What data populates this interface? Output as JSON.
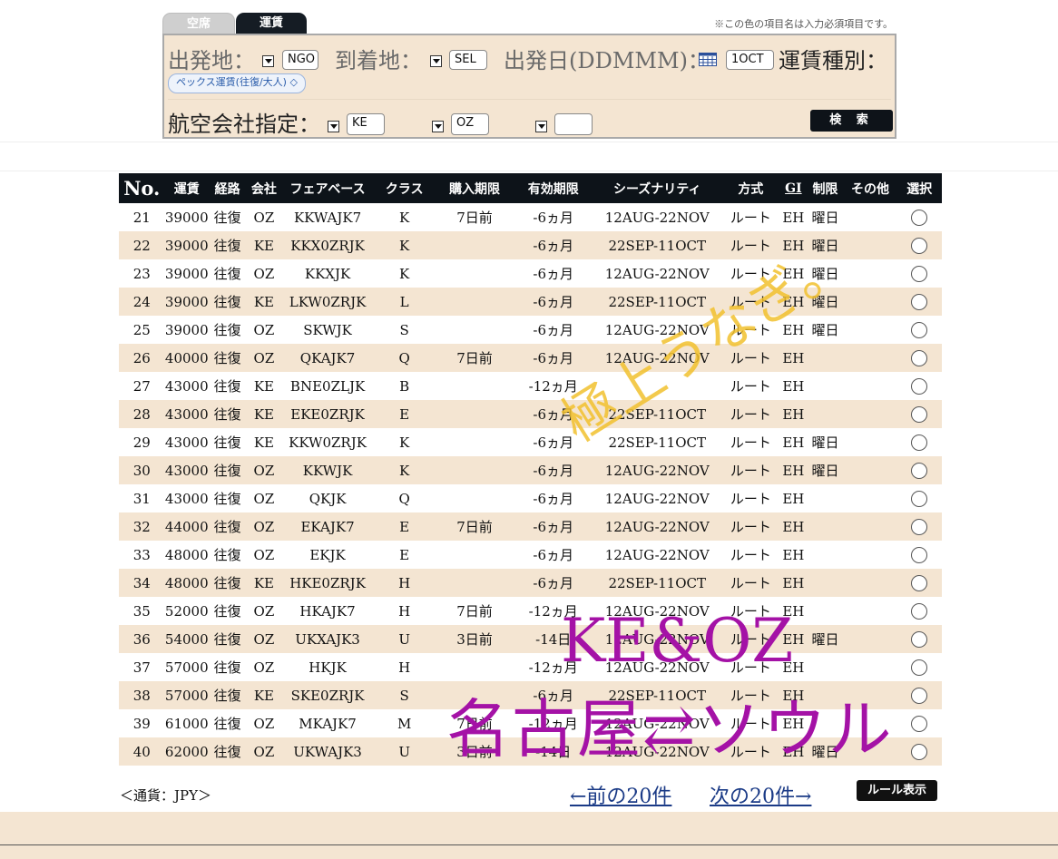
{
  "tabs": {
    "availability": "空席",
    "fare": "運賃"
  },
  "note": "※この色の項目名は入力必須項目です。",
  "search": {
    "origin_label": "出発地：",
    "origin_value": "NGO",
    "dest_label": "到着地：",
    "dest_value": "SEL",
    "date_label": "出発日(DDMMM)：",
    "date_value": "1OCT",
    "fare_type_label": "運賃種別：",
    "fare_type_value": "ペックス運賃(往復/大人)",
    "airline_label": "航空会社指定：",
    "airline1": "KE",
    "airline2": "OZ",
    "airline3": "",
    "search_button": "検 索"
  },
  "table": {
    "headers": [
      "No.",
      "運賃",
      "経路",
      "会社",
      "フェアベース",
      "クラス",
      "購入期限",
      "有効期限",
      "シーズナリティ",
      "方式",
      "GI",
      "制限",
      "その他",
      "選択"
    ],
    "rows": [
      [
        "21",
        "39000",
        "往復",
        "OZ",
        "KKWAJK7",
        "K",
        "7日前",
        "-6ヵ月",
        "12AUG-22NOV",
        "ルート",
        "EH",
        "曜日",
        ""
      ],
      [
        "22",
        "39000",
        "往復",
        "KE",
        "KKX0ZRJK",
        "K",
        "",
        "-6ヵ月",
        "22SEP-11OCT",
        "ルート",
        "EH",
        "曜日",
        ""
      ],
      [
        "23",
        "39000",
        "往復",
        "OZ",
        "KKXJK",
        "K",
        "",
        "-6ヵ月",
        "12AUG-22NOV",
        "ルート",
        "EH",
        "曜日",
        ""
      ],
      [
        "24",
        "39000",
        "往復",
        "KE",
        "LKW0ZRJK",
        "L",
        "",
        "-6ヵ月",
        "22SEP-11OCT",
        "ルート",
        "EH",
        "曜日",
        ""
      ],
      [
        "25",
        "39000",
        "往復",
        "OZ",
        "SKWJK",
        "S",
        "",
        "-6ヵ月",
        "12AUG-22NOV",
        "ルート",
        "EH",
        "曜日",
        ""
      ],
      [
        "26",
        "40000",
        "往復",
        "OZ",
        "QKAJK7",
        "Q",
        "7日前",
        "-6ヵ月",
        "12AUG-22NOV",
        "ルート",
        "EH",
        "",
        ""
      ],
      [
        "27",
        "43000",
        "往復",
        "KE",
        "BNE0ZLJK",
        "B",
        "",
        "-12ヵ月",
        "",
        "ルート",
        "EH",
        "",
        ""
      ],
      [
        "28",
        "43000",
        "往復",
        "KE",
        "EKE0ZRJK",
        "E",
        "",
        "-6ヵ月",
        "22SEP-11OCT",
        "ルート",
        "EH",
        "",
        ""
      ],
      [
        "29",
        "43000",
        "往復",
        "KE",
        "KKW0ZRJK",
        "K",
        "",
        "-6ヵ月",
        "22SEP-11OCT",
        "ルート",
        "EH",
        "曜日",
        ""
      ],
      [
        "30",
        "43000",
        "往復",
        "OZ",
        "KKWJK",
        "K",
        "",
        "-6ヵ月",
        "12AUG-22NOV",
        "ルート",
        "EH",
        "曜日",
        ""
      ],
      [
        "31",
        "43000",
        "往復",
        "OZ",
        "QKJK",
        "Q",
        "",
        "-6ヵ月",
        "12AUG-22NOV",
        "ルート",
        "EH",
        "",
        ""
      ],
      [
        "32",
        "44000",
        "往復",
        "OZ",
        "EKAJK7",
        "E",
        "7日前",
        "-6ヵ月",
        "12AUG-22NOV",
        "ルート",
        "EH",
        "",
        ""
      ],
      [
        "33",
        "48000",
        "往復",
        "OZ",
        "EKJK",
        "E",
        "",
        "-6ヵ月",
        "12AUG-22NOV",
        "ルート",
        "EH",
        "",
        ""
      ],
      [
        "34",
        "48000",
        "往復",
        "KE",
        "HKE0ZRJK",
        "H",
        "",
        "-6ヵ月",
        "22SEP-11OCT",
        "ルート",
        "EH",
        "",
        ""
      ],
      [
        "35",
        "52000",
        "往復",
        "OZ",
        "HKAJK7",
        "H",
        "7日前",
        "-12ヵ月",
        "12AUG-22NOV",
        "ルート",
        "EH",
        "",
        ""
      ],
      [
        "36",
        "54000",
        "往復",
        "OZ",
        "UKXAJK3",
        "U",
        "3日前",
        "-14日",
        "12AUG-22NOV",
        "ルート",
        "EH",
        "曜日",
        ""
      ],
      [
        "37",
        "57000",
        "往復",
        "OZ",
        "HKJK",
        "H",
        "",
        "-12ヵ月",
        "12AUG-22NOV",
        "ルート",
        "EH",
        "",
        ""
      ],
      [
        "38",
        "57000",
        "往復",
        "KE",
        "SKE0ZRJK",
        "S",
        "",
        "-6ヵ月",
        "22SEP-11OCT",
        "ルート",
        "EH",
        "",
        ""
      ],
      [
        "39",
        "61000",
        "往復",
        "OZ",
        "MKAJK7",
        "M",
        "7日前",
        "-12ヵ月",
        "12AUG-22NOV",
        "ルート",
        "EH",
        "",
        ""
      ],
      [
        "40",
        "62000",
        "往復",
        "OZ",
        "UKWAJK3",
        "U",
        "3日前",
        "-14日",
        "12AUG-22NOV",
        "ルート",
        "EH",
        "曜日",
        ""
      ]
    ]
  },
  "footer": {
    "currency": "＜通貨：JPY＞",
    "prev": "←前の20件",
    "next": "次の20件→",
    "rule_button": "ルール表示"
  },
  "overlay": {
    "yellow": "極上うなぎ。",
    "purple_line1": "KE&OZ",
    "purple_line2": "名古屋⇄ソウル"
  },
  "colors": {
    "header_bg": "#0d1319",
    "stripe": "#f4e5d2",
    "overlay_purple": "#a412a6",
    "overlay_yellow": "#f2c12e"
  }
}
